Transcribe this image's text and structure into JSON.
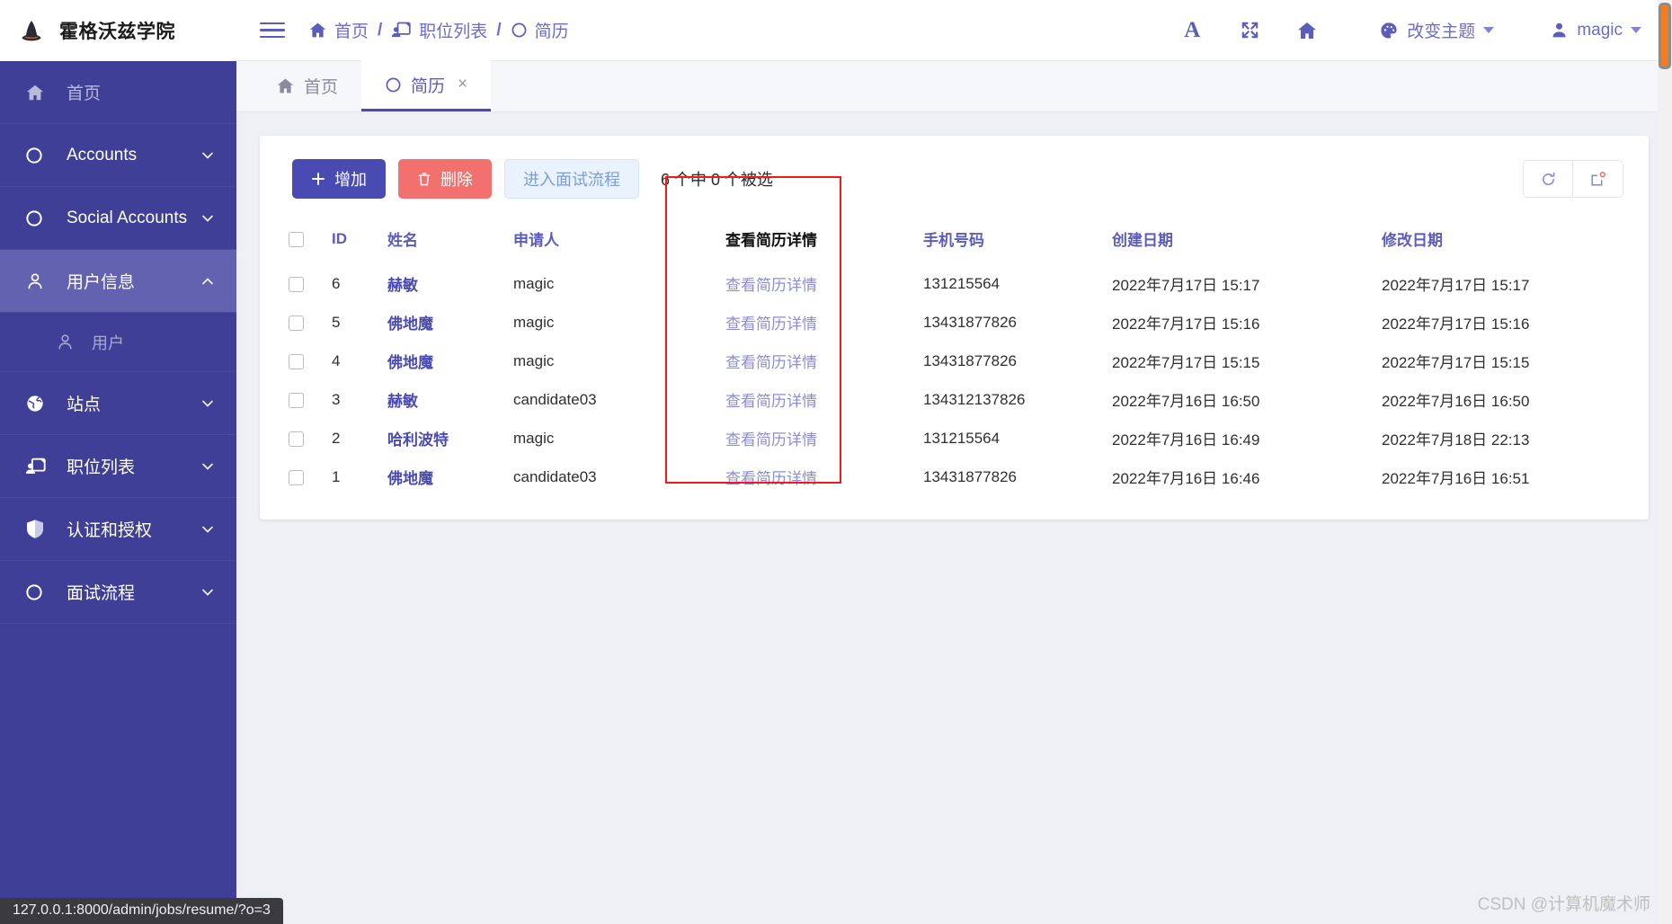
{
  "brand": {
    "title": "霍格沃兹学院",
    "logo_icon": "wizard-hat-icon"
  },
  "sidebar": {
    "items": [
      {
        "label": "首页",
        "icon": "home-icon",
        "has_chevron": false,
        "state": "dim"
      },
      {
        "label": "Accounts",
        "icon": "circle-icon",
        "has_chevron": true,
        "chevron": "down"
      },
      {
        "label": "Social Accounts",
        "icon": "circle-icon",
        "has_chevron": true,
        "chevron": "down"
      },
      {
        "label": "用户信息",
        "icon": "user-icon",
        "has_chevron": true,
        "chevron": "up",
        "state": "active"
      },
      {
        "label": "用户",
        "icon": "user-icon",
        "sub": true
      },
      {
        "label": "站点",
        "icon": "globe-icon",
        "has_chevron": true,
        "chevron": "down"
      },
      {
        "label": "职位列表",
        "icon": "job-board-icon",
        "has_chevron": true,
        "chevron": "down"
      },
      {
        "label": "认证和授权",
        "icon": "shield-icon",
        "has_chevron": true,
        "chevron": "down"
      },
      {
        "label": "面试流程",
        "icon": "circle-icon",
        "has_chevron": true,
        "chevron": "down"
      }
    ]
  },
  "topbar": {
    "menu_icon": "hamburger-icon",
    "breadcrumb": [
      {
        "label": "首页",
        "icon": "home-icon"
      },
      {
        "label": "职位列表",
        "icon": "job-board-icon"
      },
      {
        "label": "简历",
        "icon": "circle-icon"
      }
    ],
    "separator": "/",
    "icons": [
      {
        "name": "font-size-icon",
        "glyph": "A"
      },
      {
        "name": "fullscreen-icon"
      },
      {
        "name": "home-icon"
      }
    ],
    "theme": {
      "label": "改变主题",
      "icon": "palette-icon"
    },
    "user": {
      "label": "magic",
      "icon": "user-icon"
    }
  },
  "tabs": [
    {
      "label": "首页",
      "icon": "home-icon",
      "active": false,
      "closable": false
    },
    {
      "label": "简历",
      "icon": "circle-icon",
      "active": true,
      "closable": true,
      "close_glyph": "×"
    }
  ],
  "toolbar": {
    "add_label": "增加",
    "add_icon": "plus-icon",
    "delete_label": "删除",
    "delete_icon": "trash-icon",
    "interview_label": "进入面试流程",
    "selection_text": "6 个中 0 个被选",
    "refresh_icon": "refresh-icon",
    "export_icon": "export-icon"
  },
  "table": {
    "columns": [
      {
        "key": "checkbox",
        "label": ""
      },
      {
        "key": "id",
        "label": "ID"
      },
      {
        "key": "name",
        "label": "姓名"
      },
      {
        "key": "applicant",
        "label": "申请人"
      },
      {
        "key": "detail",
        "label": "查看简历详情",
        "highlight": true
      },
      {
        "key": "phone",
        "label": "手机号码"
      },
      {
        "key": "created",
        "label": "创建日期"
      },
      {
        "key": "modified",
        "label": "修改日期"
      }
    ],
    "rows": [
      {
        "id": "6",
        "name": "赫敏",
        "applicant": "magic",
        "detail": "查看简历详情",
        "phone": "131215564",
        "created": "2022年7月17日 15:17",
        "modified": "2022年7月17日 15:17"
      },
      {
        "id": "5",
        "name": "佛地魔",
        "applicant": "magic",
        "detail": "查看简历详情",
        "phone": "13431877826",
        "created": "2022年7月17日 15:16",
        "modified": "2022年7月17日 15:16"
      },
      {
        "id": "4",
        "name": "佛地魔",
        "applicant": "magic",
        "detail": "查看简历详情",
        "phone": "13431877826",
        "created": "2022年7月17日 15:15",
        "modified": "2022年7月17日 15:15"
      },
      {
        "id": "3",
        "name": "赫敏",
        "applicant": "candidate03",
        "detail": "查看简历详情",
        "phone": "134312137826",
        "created": "2022年7月16日 16:50",
        "modified": "2022年7月16日 16:50"
      },
      {
        "id": "2",
        "name": "哈利波特",
        "applicant": "magic",
        "detail": "查看简历详情",
        "phone": "131215564",
        "created": "2022年7月16日 16:49",
        "modified": "2022年7月18日 22:13"
      },
      {
        "id": "1",
        "name": "佛地魔",
        "applicant": "candidate03",
        "detail": "查看简历详情",
        "phone": "13431877826",
        "created": "2022年7月16日 16:46",
        "modified": "2022年7月16日 16:51"
      }
    ]
  },
  "annotation": {
    "color": "#ef1b1b"
  },
  "statusbar": {
    "url": "127.0.0.1:8000/admin/jobs/resume/?o=3"
  },
  "watermark": {
    "text": "CSDN @计算机魔术师"
  },
  "colors": {
    "sidebar": "#3f3f98",
    "sidebar_active": "#6262b0",
    "accent": "#4a4ab3",
    "link": "#8c8cd8",
    "danger": "#f2706e",
    "annotation": "#ef1b1b",
    "scrollbar_thumb": "#f57c20"
  }
}
